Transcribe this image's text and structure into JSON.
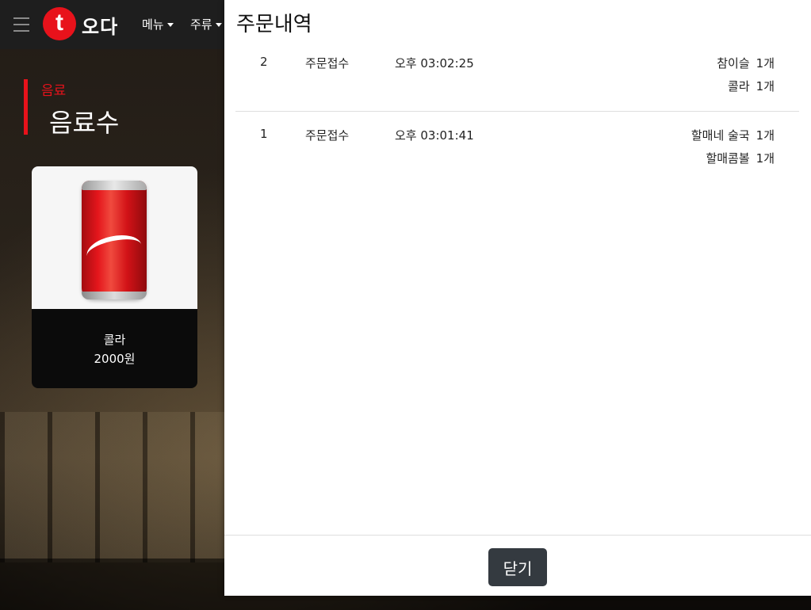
{
  "header": {
    "logo_letter": "t",
    "logo_text": "오다",
    "nav": [
      {
        "label": "메뉴"
      },
      {
        "label": "주류"
      }
    ]
  },
  "category": {
    "small_label": "음료",
    "title": "음료수"
  },
  "product": {
    "name": "콜라",
    "price": "2000원"
  },
  "modal": {
    "title": "주문내역",
    "orders": [
      {
        "number": "2",
        "status": "주문접수",
        "time": "오후 03:02:25",
        "items": [
          {
            "name": "참이슬",
            "qty": "1개"
          },
          {
            "name": "콜라",
            "qty": "1개"
          }
        ]
      },
      {
        "number": "1",
        "status": "주문접수",
        "time": "오후 03:01:41",
        "items": [
          {
            "name": "할매네 술국",
            "qty": "1개"
          },
          {
            "name": "할매콤볼",
            "qty": "1개"
          }
        ]
      }
    ],
    "close_label": "닫기"
  }
}
